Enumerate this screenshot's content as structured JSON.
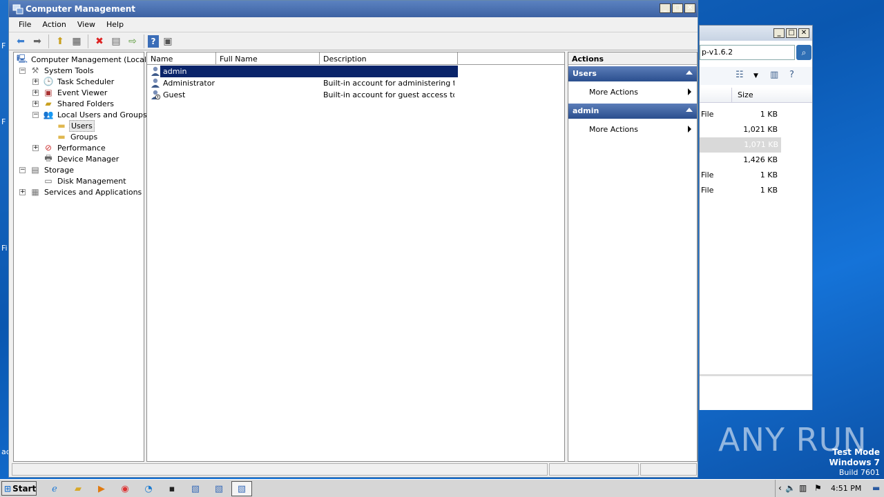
{
  "desktop": {
    "fragments": [
      "F",
      "F",
      "Fi",
      "ac"
    ]
  },
  "window": {
    "title": "Computer Management",
    "menu": [
      "File",
      "Action",
      "View",
      "Help"
    ]
  },
  "tree": {
    "root": "Computer Management (Local)",
    "system_tools": "System Tools",
    "task_scheduler": "Task Scheduler",
    "event_viewer": "Event Viewer",
    "shared_folders": "Shared Folders",
    "local_users_groups": "Local Users and Groups",
    "users": "Users",
    "groups": "Groups",
    "performance": "Performance",
    "device_manager": "Device Manager",
    "storage": "Storage",
    "disk_management": "Disk Management",
    "services_apps": "Services and Applications"
  },
  "list": {
    "columns": [
      "Name",
      "Full Name",
      "Description"
    ],
    "rows": [
      {
        "name": "admin",
        "full_name": "",
        "description": ""
      },
      {
        "name": "Administrator",
        "full_name": "",
        "description": "Built-in account for administering the…"
      },
      {
        "name": "Guest",
        "full_name": "",
        "description": "Built-in account for guest access to t…"
      }
    ]
  },
  "actions": {
    "header": "Actions",
    "sections": [
      {
        "title": "Users",
        "item": "More Actions"
      },
      {
        "title": "admin",
        "item": "More Actions"
      }
    ]
  },
  "bg_window": {
    "address": "p-v1.6.2",
    "size_header": "Size",
    "rows": [
      {
        "type": "File",
        "size": "1 KB"
      },
      {
        "type": "",
        "size": "1,021 KB"
      },
      {
        "type": "",
        "size": "1,071 KB"
      },
      {
        "type": "",
        "size": "1,426 KB"
      },
      {
        "type": "File",
        "size": "1 KB"
      },
      {
        "type": "File",
        "size": "1 KB"
      }
    ]
  },
  "watermark": "ANY RUN",
  "test_mode": {
    "line1": "Test Mode",
    "line2": "Windows 7",
    "line3": "Build 7601"
  },
  "taskbar": {
    "start": "Start",
    "clock": "4:51 PM"
  }
}
